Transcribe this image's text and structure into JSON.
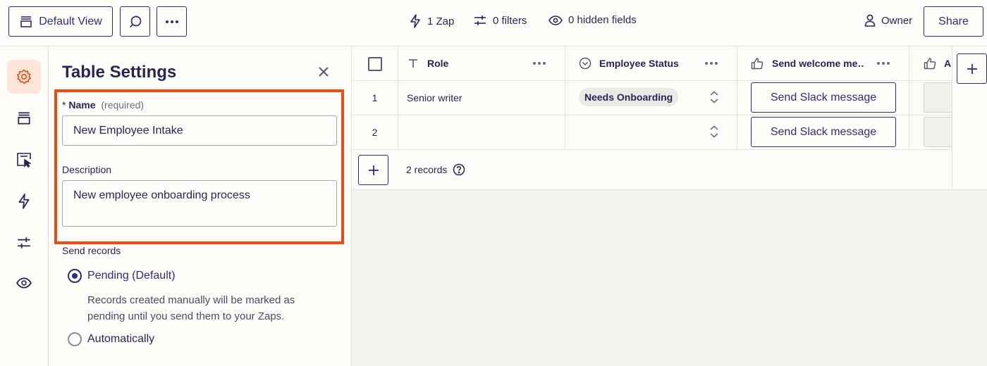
{
  "toolbar": {
    "view_label": "Default View",
    "zaps": "1 Zap",
    "filters": "0 filters",
    "hidden_fields": "0 hidden fields",
    "owner": "Owner",
    "share_label": "Share"
  },
  "rail": {
    "items": [
      "gear-icon",
      "views-icon",
      "form-icon",
      "zap-icon",
      "filters-icon",
      "eye-icon"
    ],
    "active": "gear-icon"
  },
  "panel": {
    "title": "Table Settings",
    "name_label": "Name",
    "name_required_marker": "*",
    "name_hint": "(required)",
    "name_value": "New Employee Intake",
    "description_label": "Description",
    "description_value": "New employee onboarding process",
    "send_records_label": "Send records",
    "options": [
      {
        "label": "Pending (Default)",
        "selected": true,
        "description": "Records created manually will be marked as pending until you send them to your Zaps."
      },
      {
        "label": "Automatically",
        "selected": false
      }
    ]
  },
  "table": {
    "columns": [
      {
        "name": "Role",
        "icon": "text-icon"
      },
      {
        "name": "Employee Status",
        "icon": "status-icon"
      },
      {
        "name": "Send welcome me…",
        "icon": "thumbs-up-icon"
      },
      {
        "name": "A",
        "icon": "thumbs-up-icon"
      }
    ],
    "rows": [
      {
        "num": "1",
        "role": "Senior writer",
        "status": "Needs Onboarding",
        "action": "Send Slack message"
      },
      {
        "num": "2",
        "role": "",
        "status": "",
        "action": "Send Slack message"
      }
    ],
    "record_count": "2 records"
  },
  "colors": {
    "accent": "#2d2e7a",
    "highlight": "#ef4a14",
    "active_bg": "#fde5d8",
    "badge_bg": "#ebe9e4"
  }
}
